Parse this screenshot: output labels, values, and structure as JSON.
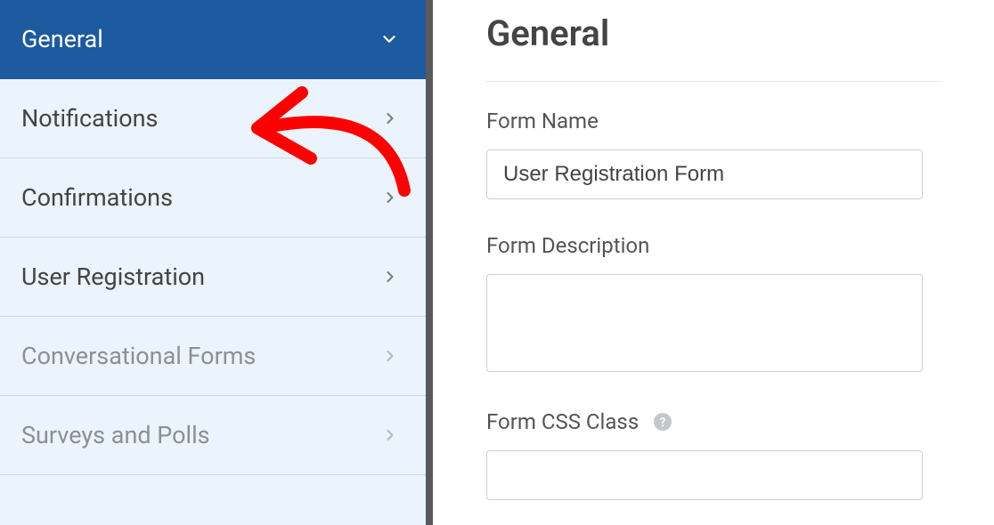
{
  "sidebar": {
    "items": [
      {
        "label": "General",
        "active": true
      },
      {
        "label": "Notifications",
        "active": false
      },
      {
        "label": "Confirmations",
        "active": false
      },
      {
        "label": "User Registration",
        "active": false
      },
      {
        "label": "Conversational Forms",
        "active": false,
        "muted": true
      },
      {
        "label": "Surveys and Polls",
        "active": false,
        "muted": true
      }
    ]
  },
  "main": {
    "title": "General",
    "form_name": {
      "label": "Form Name",
      "value": "User Registration Form"
    },
    "form_description": {
      "label": "Form Description",
      "value": ""
    },
    "form_css_class": {
      "label": "Form CSS Class",
      "value": ""
    }
  },
  "annotation": {
    "color": "#ff0000"
  }
}
